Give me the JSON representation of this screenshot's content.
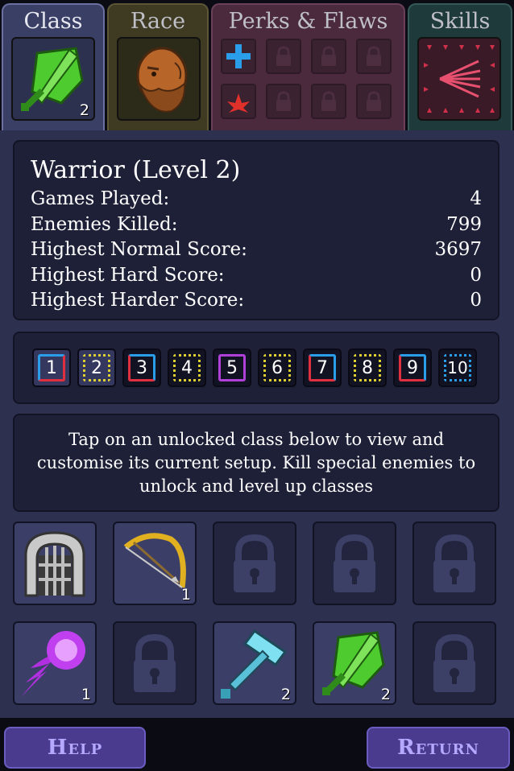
{
  "tabs": {
    "class": {
      "label": "Class",
      "badge": "2"
    },
    "race": {
      "label": "Race"
    },
    "perks": {
      "label": "Perks & Flaws"
    },
    "skills": {
      "label": "Skills"
    }
  },
  "stats": {
    "title": "Warrior (Level 2)",
    "rows": [
      {
        "label": "Games Played:",
        "value": "4"
      },
      {
        "label": "Enemies Killed:",
        "value": "799"
      },
      {
        "label": "Highest Normal Score:",
        "value": "3697"
      },
      {
        "label": "Highest Hard Score:",
        "value": "0"
      },
      {
        "label": "Highest Harder Score:",
        "value": "0"
      }
    ]
  },
  "levels": [
    "1",
    "2",
    "3",
    "4",
    "5",
    "6",
    "7",
    "8",
    "9",
    "10"
  ],
  "info": {
    "text": "Tap on an unlocked class below to view and customise its current setup. Kill special enemies to unlock and level up classes"
  },
  "classes": {
    "row1": [
      {
        "icon": "gate-icon",
        "badge": ""
      },
      {
        "icon": "bow-icon",
        "badge": "1"
      },
      {
        "icon": "lock-icon",
        "badge": ""
      },
      {
        "icon": "lock-icon",
        "badge": ""
      },
      {
        "icon": "lock-icon",
        "badge": ""
      }
    ],
    "row2": [
      {
        "icon": "fireball-icon",
        "badge": "1"
      },
      {
        "icon": "lock-icon",
        "badge": ""
      },
      {
        "icon": "hammer-icon",
        "badge": "2"
      },
      {
        "icon": "sword-shield-icon",
        "badge": "2"
      },
      {
        "icon": "lock-icon",
        "badge": ""
      }
    ]
  },
  "buttons": {
    "help": "Help",
    "return": "Return"
  },
  "colors": {
    "accent": "#6a5cc0",
    "panel": "#1e2038",
    "background": "#2e3050"
  }
}
